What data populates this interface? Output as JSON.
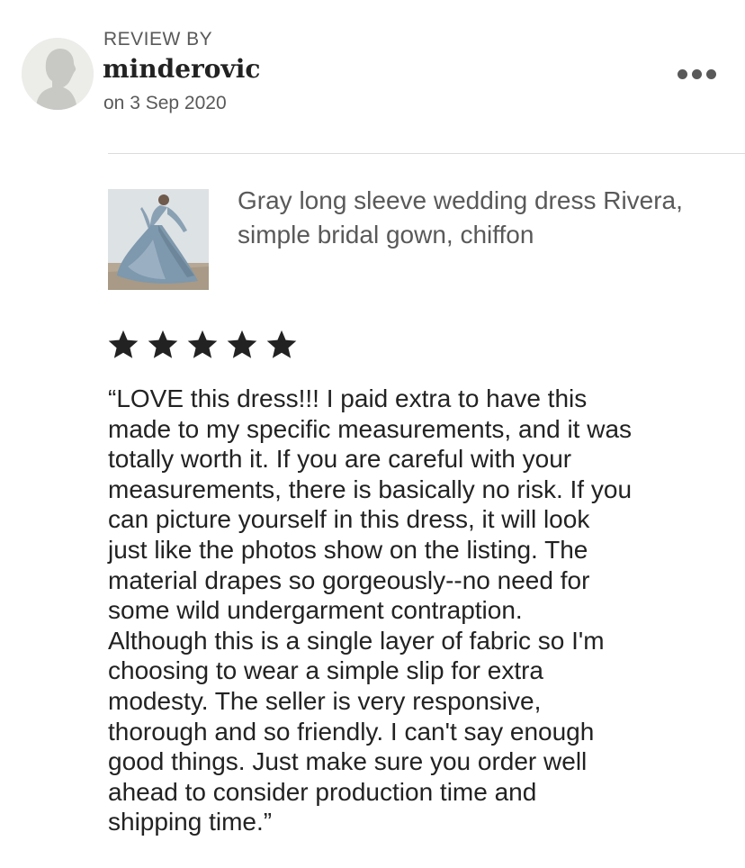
{
  "review": {
    "label": "REVIEW BY",
    "reviewer": "minderovic",
    "date": "on 3 Sep 2020",
    "rating": 5
  },
  "listing": {
    "title": "Gray long sleeve wedding dress Rivera, simple bridal gown, chiffon"
  },
  "review_text": "“LOVE this dress!!! I paid extra to have this\nmade to my specific measurements, and it was\ntotally worth it. If you are careful with your\nmeasurements, there is basically no risk. If you\ncan picture yourself in this dress, it will look\njust like the photos show on the listing. The\nmaterial drapes so gorgeously--no need for\nsome wild undergarment contraption.\nAlthough this is a single layer of fabric so I'm\nchoosing to wear a simple slip for extra\nmodesty.  The seller is very responsive,\nthorough and so friendly. I can't say enough\ngood things. Just make sure you order well\nahead to consider production time and\nshipping time.”",
  "icons": {
    "avatar": "default-user-avatar-icon",
    "more": "more-options-icon",
    "star": "star-icon"
  },
  "colors": {
    "primary_text": "#222222",
    "secondary_text": "#595959",
    "divider": "#dcdcdc",
    "avatar_bg": "#ecece9",
    "avatar_silhouette": "#c8c8c5"
  }
}
